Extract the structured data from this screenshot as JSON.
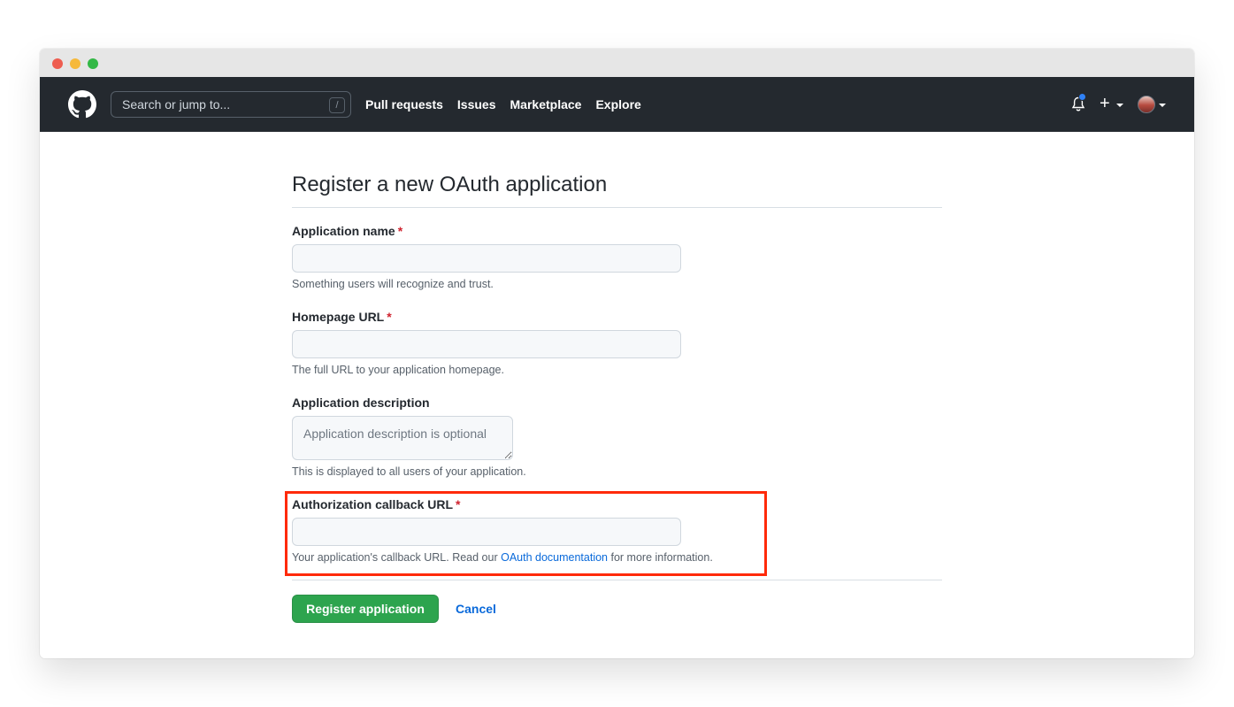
{
  "header": {
    "search_placeholder": "Search or jump to...",
    "search_shortcut": "/",
    "nav": [
      "Pull requests",
      "Issues",
      "Marketplace",
      "Explore"
    ],
    "plus_label": "+"
  },
  "page": {
    "title": "Register a new OAuth application"
  },
  "form": {
    "app_name": {
      "label": "Application name",
      "required_mark": "*",
      "value": "",
      "help": "Something users will recognize and trust."
    },
    "homepage_url": {
      "label": "Homepage URL",
      "required_mark": "*",
      "value": "",
      "help": "The full URL to your application homepage."
    },
    "description": {
      "label": "Application description",
      "placeholder": "Application description is optional",
      "help": "This is displayed to all users of your application."
    },
    "callback_url": {
      "label": "Authorization callback URL",
      "required_mark": "*",
      "value": "",
      "help_prefix": "Your application's callback URL. Read our ",
      "help_link": "OAuth documentation",
      "help_suffix": " for more information."
    }
  },
  "actions": {
    "register_label": "Register application",
    "cancel_label": "Cancel"
  },
  "colors": {
    "header_bg": "#24292f",
    "primary_button": "#2da44e",
    "link": "#0969da",
    "required": "#cf222e",
    "highlight_box": "#ff2a0a"
  }
}
